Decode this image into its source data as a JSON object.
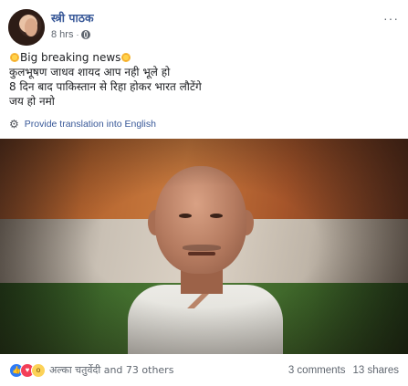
{
  "post": {
    "author": "स्त्री पाठक",
    "time": "8 hrs",
    "text": {
      "line1": "Big breaking news",
      "line2": "कुलभूषण जाधव शायद आप नही भूले हो",
      "line3": "8 दिन बाद पाकिस्तान से रिहा होकर भारत लौटेंगे",
      "line4": "जय हो नमो"
    },
    "translate_label": "Provide translation into English"
  },
  "footer": {
    "reactions_text": "अल्का चतुर्वेदी and 73 others",
    "comments": "3 comments",
    "shares": "13 shares"
  },
  "icons": {
    "reactions": [
      "like-icon",
      "love-icon",
      "wow-icon"
    ],
    "emoji": "sun-icon"
  },
  "colors": {
    "link": "#385898",
    "meta": "#606770",
    "like": "#2e7bf6",
    "love": "#f33e58",
    "wow": "#fcd258"
  }
}
